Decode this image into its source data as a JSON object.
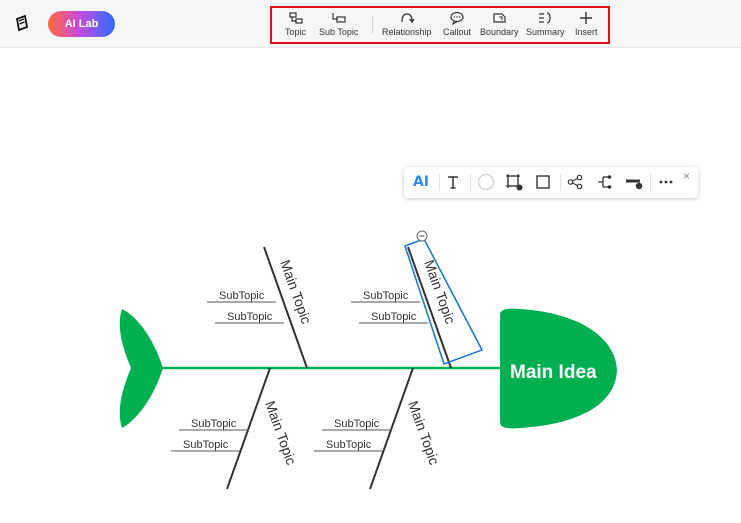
{
  "header": {
    "ai_lab_label": "AI Lab",
    "tools": [
      {
        "label": "Topic",
        "icon": "topic-icon"
      },
      {
        "label": "Sub Topic",
        "icon": "sub-topic-icon"
      },
      {
        "label": "Relationship",
        "icon": "relationship-icon"
      },
      {
        "label": "Callout",
        "icon": "callout-icon"
      },
      {
        "label": "Boundary",
        "icon": "boundary-icon"
      },
      {
        "label": "Summary",
        "icon": "summary-icon"
      },
      {
        "label": "Insert",
        "icon": "plus-icon"
      }
    ],
    "highlight_color": "#e3101c"
  },
  "float_toolbar": {
    "ai_label": "AI",
    "close_glyph": "×",
    "tools": [
      "ai-icon",
      "text-icon",
      "fill-circle-icon",
      "shape-border-icon",
      "rectangle-shape-icon",
      "connect-icon",
      "branch-icon",
      "line-style-icon",
      "more-icon",
      "close-icon"
    ]
  },
  "diagram": {
    "main_idea": "Main Idea",
    "main_topic_label": "Main Topic",
    "subtopic_label": "SubTopic",
    "collapse_glyph": "−",
    "accent_color": "#00b050",
    "selection_color": "#1f7bd1"
  }
}
